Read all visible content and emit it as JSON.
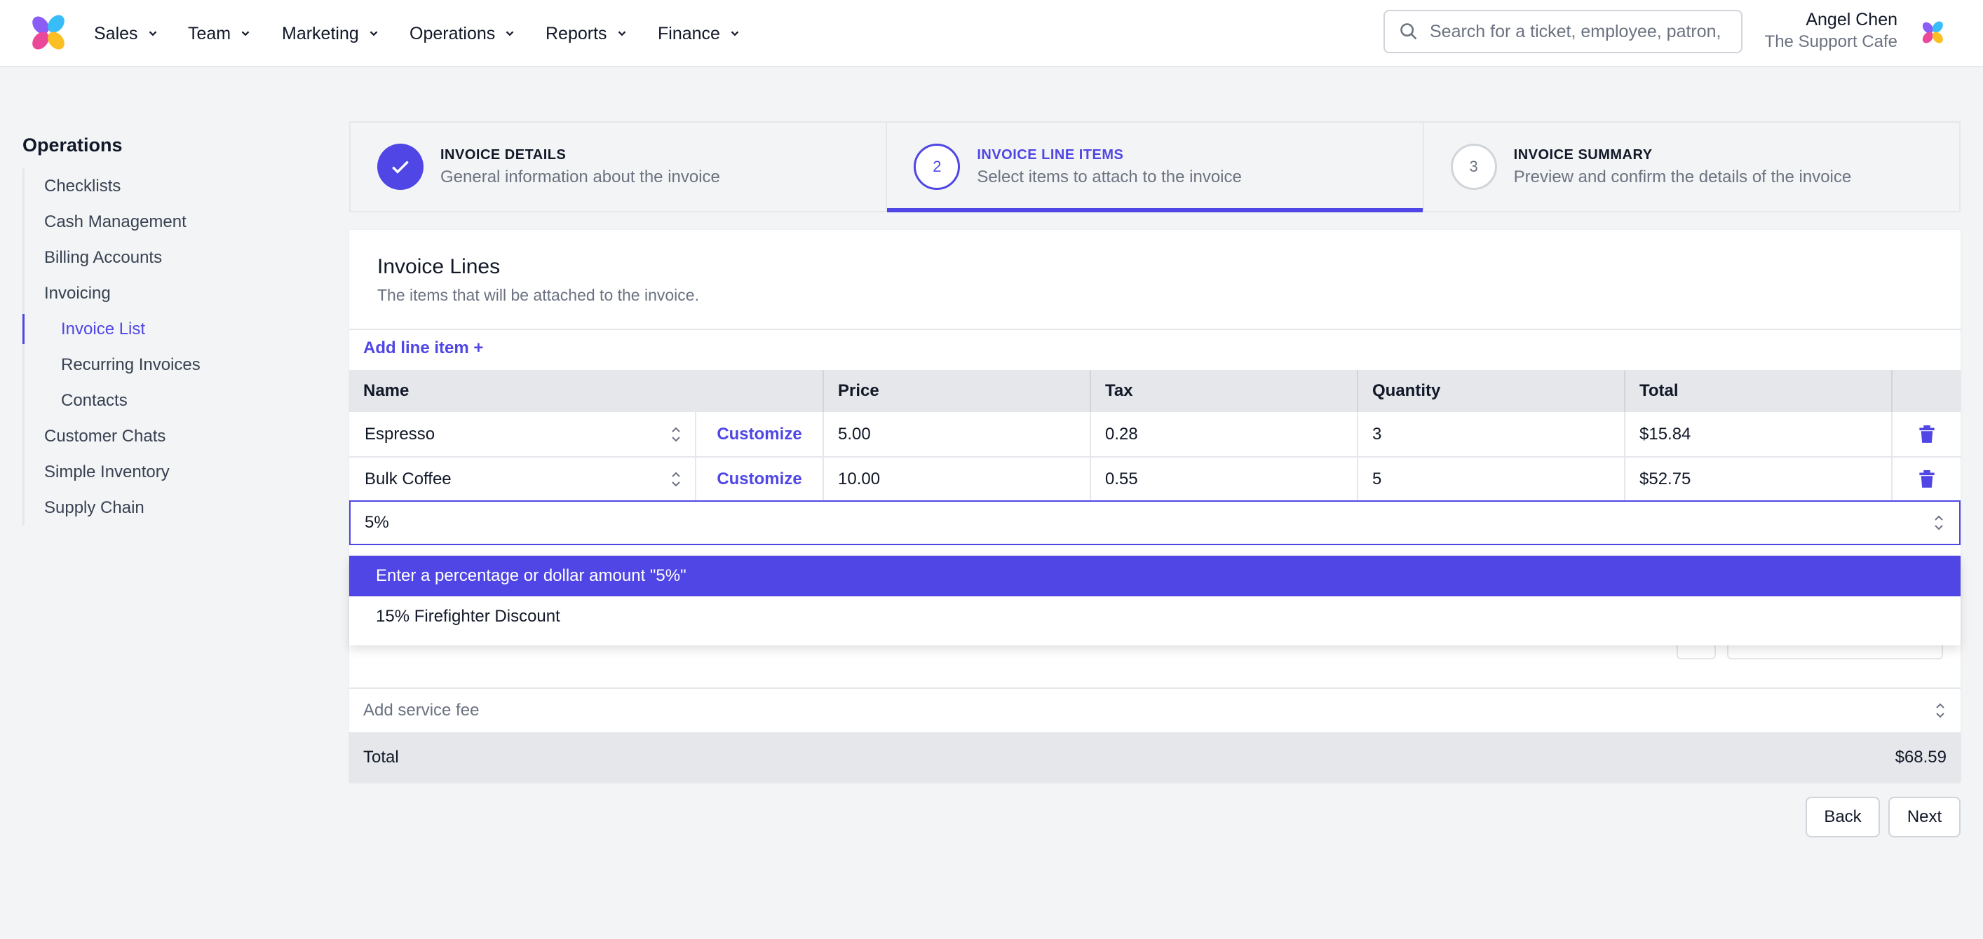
{
  "nav": {
    "items": [
      {
        "label": "Sales"
      },
      {
        "label": "Team"
      },
      {
        "label": "Marketing"
      },
      {
        "label": "Operations"
      },
      {
        "label": "Reports"
      },
      {
        "label": "Finance"
      }
    ],
    "search_placeholder": "Search for a ticket, employee, patron, p",
    "user_name": "Angel Chen",
    "user_company": "The Support Cafe"
  },
  "sidebar": {
    "title": "Operations",
    "items": [
      {
        "label": "Checklists"
      },
      {
        "label": "Cash Management"
      },
      {
        "label": "Billing Accounts"
      },
      {
        "label": "Invoicing"
      },
      {
        "label": "Invoice List",
        "active": true
      },
      {
        "label": "Recurring Invoices"
      },
      {
        "label": "Contacts"
      },
      {
        "label": "Customer Chats"
      },
      {
        "label": "Simple Inventory"
      },
      {
        "label": "Supply Chain"
      }
    ]
  },
  "stepper": {
    "steps": [
      {
        "number": "1",
        "title": "INVOICE DETAILS",
        "description": "General information about the invoice",
        "state": "complete"
      },
      {
        "number": "2",
        "title": "INVOICE LINE ITEMS",
        "description": "Select items to attach to the invoice",
        "state": "current"
      },
      {
        "number": "3",
        "title": "INVOICE SUMMARY",
        "description": "Preview and confirm the details of the invoice",
        "state": "upcoming"
      }
    ]
  },
  "invoice": {
    "title": "Invoice Lines",
    "subtitle": "The items that will be attached to the invoice.",
    "add_line_label": "Add line item +",
    "columns": [
      "Name",
      "Price",
      "Tax",
      "Quantity",
      "Total"
    ],
    "customize_label": "Customize",
    "rows": [
      {
        "name": "Espresso",
        "price": "5.00",
        "tax": "0.28",
        "quantity": "3",
        "total": "$15.84"
      },
      {
        "name": "Bulk Coffee",
        "price": "10.00",
        "tax": "0.55",
        "quantity": "5",
        "total": "$52.75"
      }
    ],
    "discount_value": "5%",
    "dropdown_options": [
      {
        "label": "Enter a percentage or dollar amount \"5%\"",
        "highlighted": true
      },
      {
        "label": "15% Firefighter Discount"
      }
    ],
    "service_fee_placeholder": "Add service fee",
    "total_label": "Total",
    "total_value": "$68.59"
  },
  "actions": {
    "back_label": "Back",
    "next_label": "Next"
  },
  "colors": {
    "accent": "#4f46e5",
    "background": "#f3f4f6"
  }
}
